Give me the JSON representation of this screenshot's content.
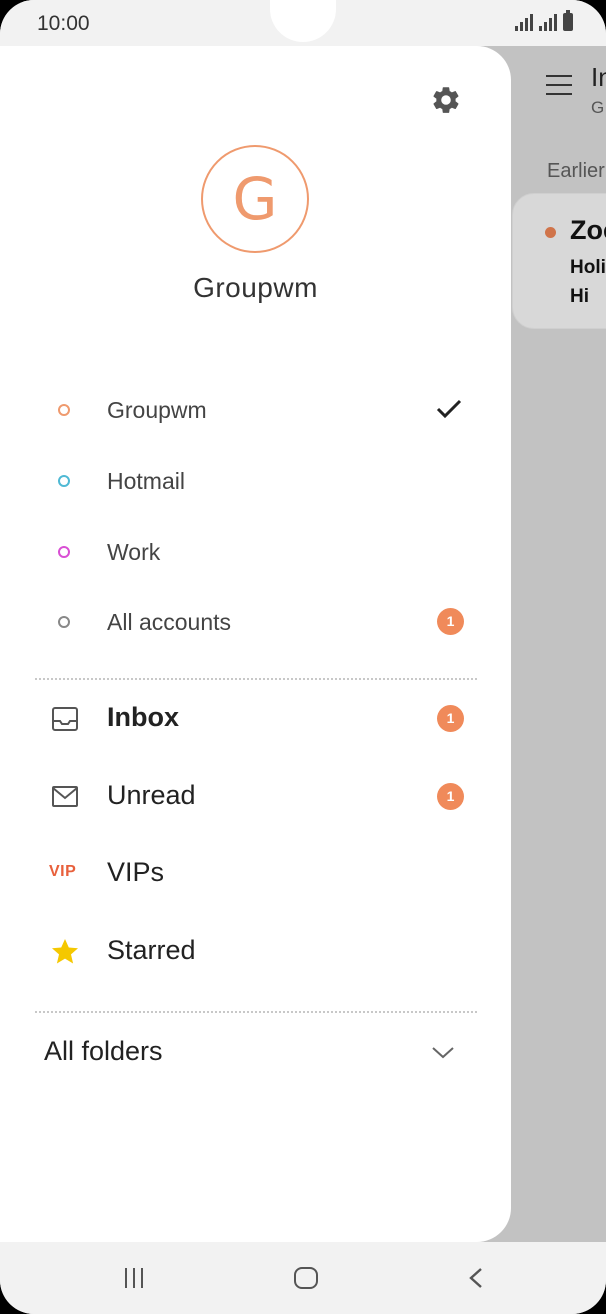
{
  "status_bar": {
    "time": "10:00"
  },
  "background": {
    "title": "In",
    "subtitle": "G",
    "section": "Earlier",
    "email": {
      "sender": "Zoe",
      "subject": "Holi",
      "preview": "Hi"
    }
  },
  "drawer": {
    "avatar_letter": "G",
    "account_name": "Groupwm",
    "accounts": [
      {
        "label": "Groupwm",
        "color": "#ef9a6e",
        "selected": true
      },
      {
        "label": "Hotmail",
        "color": "#4fb9d4"
      },
      {
        "label": "Work",
        "color": "#d94fd4"
      },
      {
        "label": "All accounts",
        "color": "#888888",
        "badge": "1"
      }
    ],
    "folders": [
      {
        "label": "Inbox",
        "badge": "1",
        "icon": "inbox-icon"
      },
      {
        "label": "Unread",
        "badge": "1",
        "icon": "envelope-icon"
      },
      {
        "label": "VIPs",
        "icon_text": "VIP"
      },
      {
        "label": "Starred",
        "icon": "star-icon"
      }
    ],
    "all_folders_label": "All folders"
  },
  "colors": {
    "accent": "#f08a5a",
    "vip": "#e8603c",
    "star": "#f5c800"
  }
}
